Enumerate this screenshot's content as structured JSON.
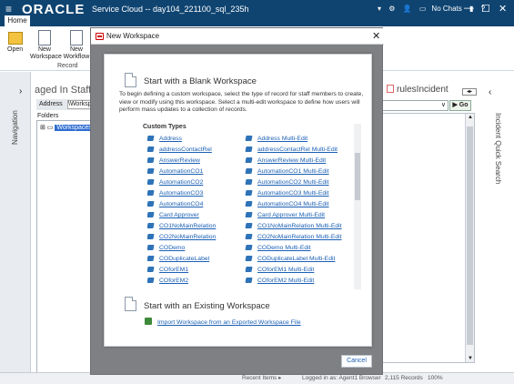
{
  "window": {
    "logo": "ORACLE",
    "title": "Service Cloud -- day104_221100_sql_235h",
    "no_chats": "No Chats",
    "controls": {
      "minimize": "—",
      "maximize": "☐",
      "close": "✕"
    }
  },
  "ribbon": {
    "tab": "Home",
    "group_label": "Record",
    "buttons": [
      {
        "label": "Open"
      },
      {
        "label": "New\nWorkspace"
      },
      {
        "label": "New\nWorkflow"
      }
    ]
  },
  "left_panel": {
    "nav_label": "Navigation",
    "title": "aged In Staff Ac",
    "address_label": "Address",
    "address_value": "\\Worksp",
    "folders_label": "Folders",
    "tree_node": "Workspaces"
  },
  "right_panel": {
    "tab_title": "rulesIncident",
    "dropdown_value": "∨",
    "go_label": "Go",
    "side_label": "Incident Quick Search"
  },
  "statusbar": {
    "recent": "Recent Items ▸",
    "logged_in": "Logged in as: Agent1 Browser",
    "records": "2,115 Records",
    "zoom": "100%"
  },
  "dialog": {
    "title": "New Workspace",
    "blank_heading": "Start with a Blank Workspace",
    "description": "To begin defining a custom workspace, select the type of record for staff members to create, view or modify using this workspace. Select a multi-edit workspace to define how users will perform mass updates to a collection of records.",
    "custom_types_label": "Custom Types",
    "items_left": [
      "Address",
      "addressContactRel",
      "AnswerReview",
      "AutomationCO1",
      "AutomationCO2",
      "AutomationCO3",
      "AutomationCO4",
      "Card Approver",
      "CO1NoMainRelation",
      "CO2NoMainRelation",
      "CODemo",
      "CODuplicateLabel",
      "COforEM1",
      "COforEM2"
    ],
    "items_right": [
      "Address Multi-Edit",
      "addressContactRel Multi-Edit",
      "AnswerReview Multi-Edit",
      "AutomationCO1 Multi-Edit",
      "AutomationCO2 Multi-Edit",
      "AutomationCO3 Multi-Edit",
      "AutomationCO4 Multi-Edit",
      "Card Approver Multi-Edit",
      "CO1NoMainRelation Multi-Edit",
      "CO2NoMainRelation Multi-Edit",
      "CODemo Multi-Edit",
      "CODuplicateLabel Multi-Edit",
      "COforEM1 Multi-Edit",
      "COforEM2 Multi-Edit"
    ],
    "existing_heading": "Start with an Existing Workspace",
    "import_link": "Import Workspace from an Exported Workspace File",
    "cancel_label": "Cancel"
  },
  "icons": [
    "menu-icon",
    "settings-icon",
    "user-icon",
    "chat-icon",
    "signal-icon",
    "help-icon",
    "open-folder-icon",
    "new-workspace-icon",
    "new-workflow-icon",
    "document-icon",
    "object-icon",
    "import-icon",
    "close-icon"
  ]
}
